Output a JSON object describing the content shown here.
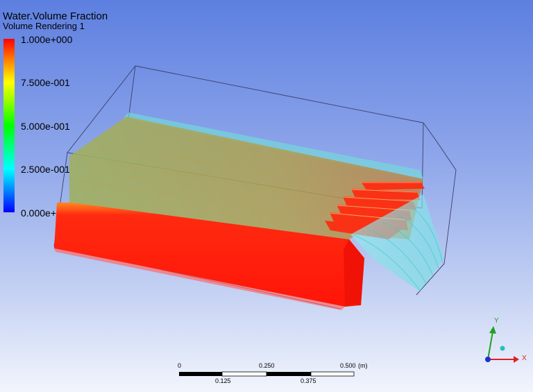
{
  "legend": {
    "title": "Water.Volume Fraction",
    "subtitle": "Volume Rendering 1",
    "ticks": [
      "1.000e+000",
      "7.500e-001",
      "5.000e-001",
      "2.500e-001",
      "0.000e+000"
    ]
  },
  "scale": {
    "top_labels": [
      "0",
      "0.250",
      "0.500",
      "(m)"
    ],
    "bottom_labels": [
      "0.125",
      "0.375"
    ]
  },
  "axes": {
    "x_label": "X",
    "y_label": "Y",
    "x_color": "#e02020",
    "y_color": "#20a020",
    "z_color": "#2030d0"
  },
  "colors": {
    "water_full": "#ff1a0a",
    "water_mix": "#a8a848",
    "water_low": "#7fe8e8"
  }
}
